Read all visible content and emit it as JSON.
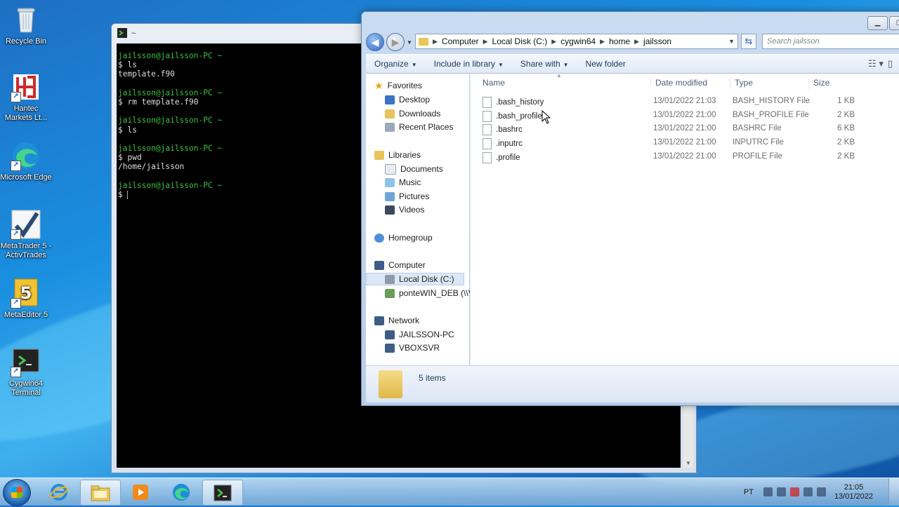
{
  "desktop": {
    "icons": [
      {
        "label": "Recycle Bin"
      },
      {
        "label": "Hantec Markets Lt..."
      },
      {
        "label": "Microsoft Edge"
      },
      {
        "label": "MetaTrader 5 - ActivTrades"
      },
      {
        "label": "MetaEditor 5"
      },
      {
        "label": "Cygwin64 Terminal"
      }
    ]
  },
  "terminal": {
    "title": "~",
    "prompt": "jailsson@jailsson-PC ~",
    "blocks": [
      {
        "command": "$ ls",
        "output": "template.f90"
      },
      {
        "command": "$ rm template.f90",
        "output": ""
      },
      {
        "command": "$ ls",
        "output": ""
      },
      {
        "command": "$ pwd",
        "output": "/home/jailsson"
      },
      {
        "command": "$ ",
        "output": ""
      }
    ]
  },
  "explorer": {
    "address": [
      "Computer",
      "Local Disk (C:)",
      "cygwin64",
      "home",
      "jailsson"
    ],
    "search_placeholder": "Search jailsson",
    "toolbar": {
      "organize": "Organize",
      "include": "Include in library",
      "share": "Share with",
      "new_folder": "New folder"
    },
    "nav": {
      "favorites": "Favorites",
      "desktop": "Desktop",
      "downloads": "Downloads",
      "recent": "Recent Places",
      "libraries": "Libraries",
      "documents": "Documents",
      "music": "Music",
      "pictures": "Pictures",
      "videos": "Videos",
      "homegroup": "Homegroup",
      "computer": "Computer",
      "local_disk": "Local Disk (C:)",
      "ponte": "ponteWIN_DEB (\\\\VI",
      "network": "Network",
      "jailsson_pc": "JAILSSON-PC",
      "vboxsvr": "VBOXSVR"
    },
    "columns": {
      "name": "Name",
      "date": "Date modified",
      "type": "Type",
      "size": "Size"
    },
    "files": [
      {
        "name": ".bash_history",
        "date": "13/01/2022 21:03",
        "type": "BASH_HISTORY File",
        "size": "1 KB"
      },
      {
        "name": ".bash_profile",
        "date": "13/01/2022 21:00",
        "type": "BASH_PROFILE File",
        "size": "2 KB"
      },
      {
        "name": ".bashrc",
        "date": "13/01/2022 21:00",
        "type": "BASHRC File",
        "size": "6 KB"
      },
      {
        "name": ".inputrc",
        "date": "13/01/2022 21:00",
        "type": "INPUTRC File",
        "size": "2 KB"
      },
      {
        "name": ".profile",
        "date": "13/01/2022 21:00",
        "type": "PROFILE File",
        "size": "2 KB"
      }
    ],
    "status": "5 items"
  },
  "taskbar": {
    "lang": "PT",
    "time": "21:05",
    "date": "13/01/2022"
  }
}
